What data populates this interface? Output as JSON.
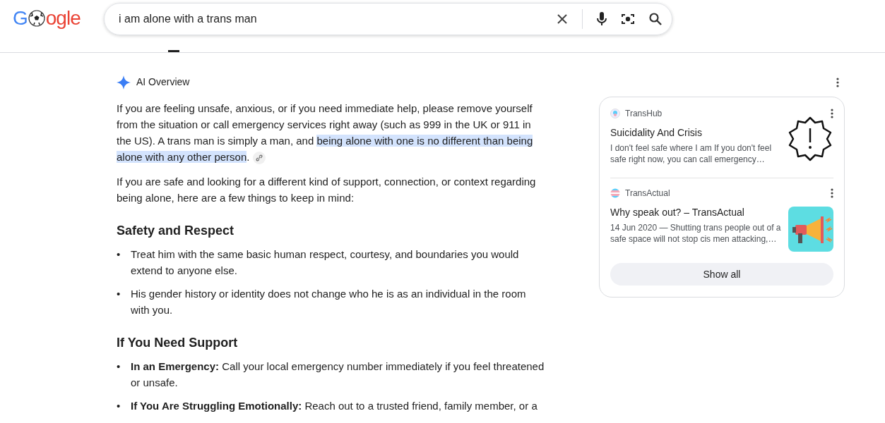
{
  "header": {
    "logo": [
      {
        "text": "G",
        "color": "#4285f4"
      },
      {
        "text": "ogle",
        "color": "#ea4335"
      }
    ],
    "search": {
      "value": "i am alone with a trans man"
    }
  },
  "overview": {
    "title": "AI Overview",
    "intro": [
      {
        "text": "If you are feeling unsafe, anxious, or if you need immediate help, please remove yourself from the situation or call emergency services right away (such as 999 in the UK or 911 in the US). A trans man is simply a man, and ",
        "highlighted": false
      },
      {
        "text": "being alone with one is no different than being alone with any other person",
        "highlighted": true
      },
      {
        "text": ".",
        "highlighted": false
      }
    ],
    "paragraph": "If you are safe and looking for a different kind of support, connection, or context regarding being alone, here are a few things to keep in mind:",
    "sections": [
      {
        "heading": "Safety and Respect",
        "items": [
          {
            "marker": "•",
            "text": "Treat him with the same basic human respect, courtesy, and boundaries you would extend to anyone else."
          },
          {
            "marker": "•",
            "text": "His gender history or identity does not change who he is as an individual in the room with you."
          }
        ]
      },
      {
        "heading": "If You Need Support",
        "items": [
          {
            "marker": "•",
            "text": "**In an Emergency:** Call your local emergency number immediately if you feel threatened or unsafe."
          },
          {
            "marker": "•",
            "text": "**If You Are Struggling Emotionally:** Reach out to a trusted friend, family member, or a"
          }
        ]
      }
    ]
  },
  "sources": {
    "cards": [
      {
        "site": "TransHub",
        "title": "Suicidality And Crisis",
        "snippet": "I don't feel safe where I am If you don't feel safe right now, you can call emergency…",
        "kind": "alert"
      },
      {
        "site": "TransActual",
        "title": "Why speak out? – TransActual",
        "snippet": "14 Jun 2020 — Shutting trans people out of a safe space will not stop cis men attacking,…",
        "kind": "picture"
      }
    ],
    "button": "Show all"
  }
}
